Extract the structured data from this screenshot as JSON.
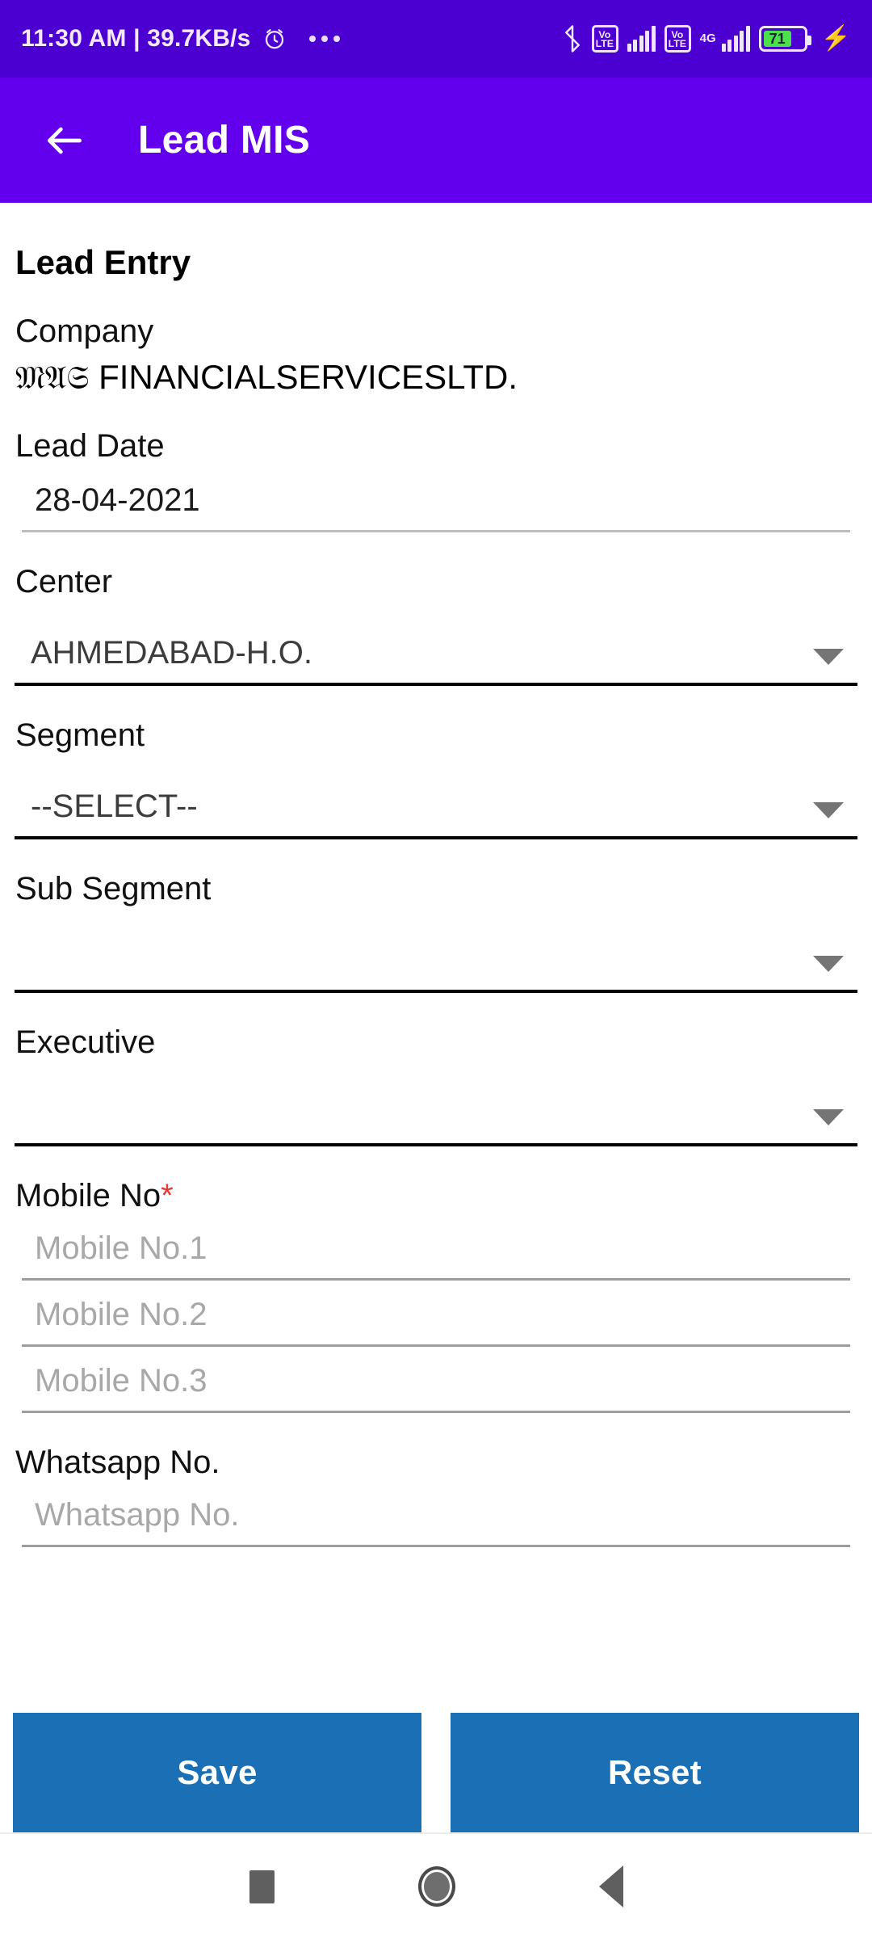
{
  "status_bar": {
    "clock": "11:30 AM | 39.7KB/s",
    "alarm_icon": "alarm-icon",
    "overflow_icon": "more-dots-icon",
    "bluetooth_icon": "bluetooth-icon",
    "volte_label_1": "Vo",
    "volte_label_2": "LTE",
    "network_type": "4G",
    "battery_percent": "71",
    "charging_icon": "charging-bolt-icon"
  },
  "app_bar": {
    "back_icon": "back-arrow-icon",
    "title": "Lead MIS",
    "background": "#6200EE"
  },
  "form": {
    "section_title": "Lead Entry",
    "company": {
      "label": "Company",
      "value_script": "𝔐𝔄𝔖",
      "value_rest": " FINANCIALSERVICESLTD."
    },
    "lead_date": {
      "label": "Lead Date",
      "value": "28-04-2021"
    },
    "center": {
      "label": "Center",
      "value": "AHMEDABAD-H.O."
    },
    "segment": {
      "label": "Segment",
      "value": "--SELECT--"
    },
    "sub_segment": {
      "label": "Sub Segment",
      "value": ""
    },
    "executive": {
      "label": "Executive",
      "value": ""
    },
    "mobile": {
      "label": "Mobile No",
      "required_mark": "*",
      "placeholder_1": "Mobile No.1",
      "placeholder_2": "Mobile No.2",
      "placeholder_3": "Mobile No.3"
    },
    "whatsapp": {
      "label": "Whatsapp No.",
      "placeholder": "Whatsapp No."
    }
  },
  "actions": {
    "save_label": "Save",
    "reset_label": "Reset",
    "button_color": "#1A6FB5"
  },
  "nav_bar": {
    "recents_icon": "square-recents-icon",
    "home_icon": "circle-home-icon",
    "back_icon": "triangle-back-icon"
  }
}
